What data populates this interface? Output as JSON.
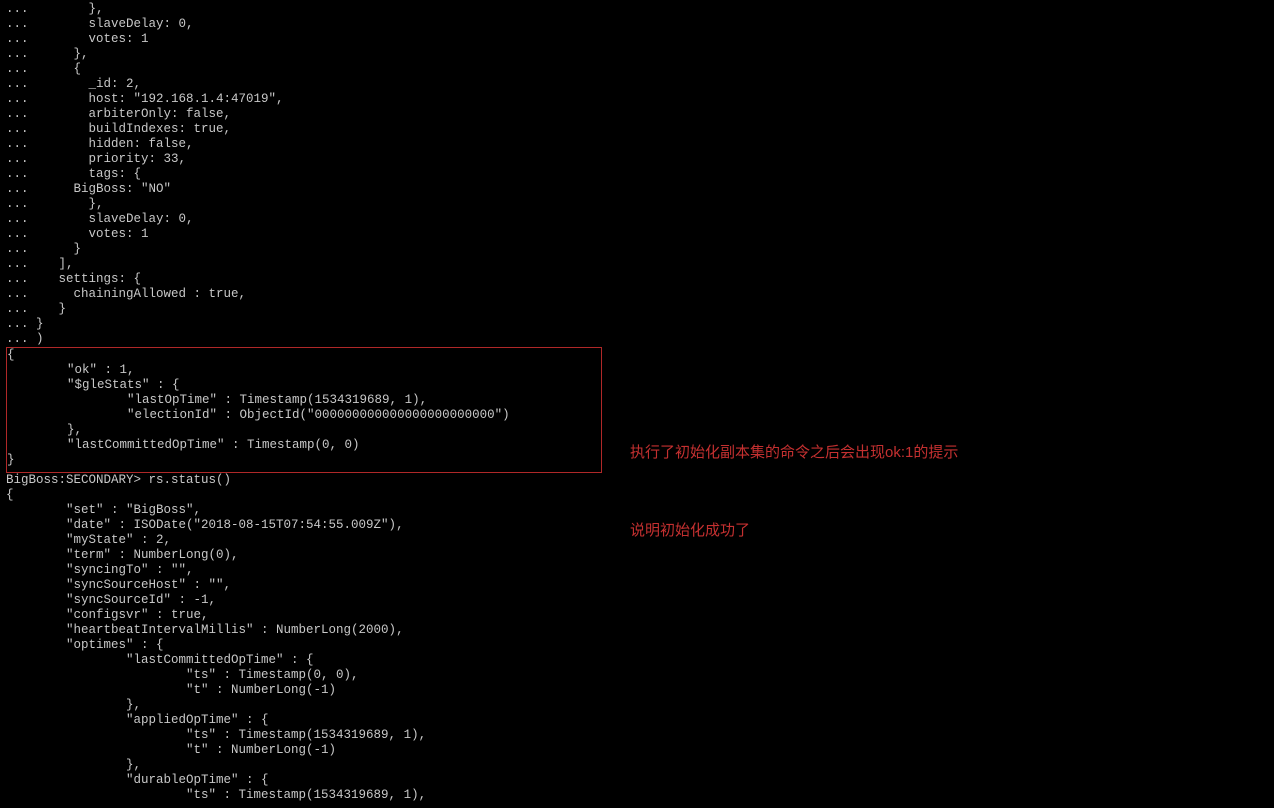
{
  "block1": {
    "lines": [
      "...        },",
      "...        slaveDelay: 0,",
      "...        votes: 1",
      "...      },",
      "...      {",
      "...        _id: 2,",
      "...        host: \"192.168.1.4:47019\",",
      "...        arbiterOnly: false,",
      "...        buildIndexes: true,",
      "...        hidden: false,",
      "...        priority: 33,",
      "...        tags: {",
      "...      BigBoss: \"NO\"",
      "...        },",
      "...        slaveDelay: 0,",
      "...        votes: 1",
      "...      }",
      "...    ],",
      "...    settings: {",
      "...      chainingAllowed : true,",
      "...    }",
      "... }",
      "... )"
    ]
  },
  "boxed": {
    "lines": [
      "{",
      "        \"ok\" : 1,",
      "        \"$gleStats\" : {",
      "                \"lastOpTime\" : Timestamp(1534319689, 1),",
      "                \"electionId\" : ObjectId(\"000000000000000000000000\")",
      "        },",
      "        \"lastCommittedOpTime\" : Timestamp(0, 0)",
      "}"
    ]
  },
  "block2": {
    "lines": [
      "BigBoss:SECONDARY> rs.status()",
      "{",
      "        \"set\" : \"BigBoss\",",
      "        \"date\" : ISODate(\"2018-08-15T07:54:55.009Z\"),",
      "        \"myState\" : 2,",
      "        \"term\" : NumberLong(0),",
      "        \"syncingTo\" : \"\",",
      "        \"syncSourceHost\" : \"\",",
      "        \"syncSourceId\" : -1,",
      "        \"configsvr\" : true,",
      "        \"heartbeatIntervalMillis\" : NumberLong(2000),",
      "        \"optimes\" : {",
      "                \"lastCommittedOpTime\" : {",
      "                        \"ts\" : Timestamp(0, 0),",
      "                        \"t\" : NumberLong(-1)",
      "                },",
      "                \"appliedOpTime\" : {",
      "                        \"ts\" : Timestamp(1534319689, 1),",
      "                        \"t\" : NumberLong(-1)",
      "                },",
      "                \"durableOpTime\" : {",
      "                        \"ts\" : Timestamp(1534319689, 1),"
    ]
  },
  "annotation": {
    "line1": "执行了初始化副本集的命令之后会出现ok:1的提示",
    "line2": "说明初始化成功了"
  }
}
